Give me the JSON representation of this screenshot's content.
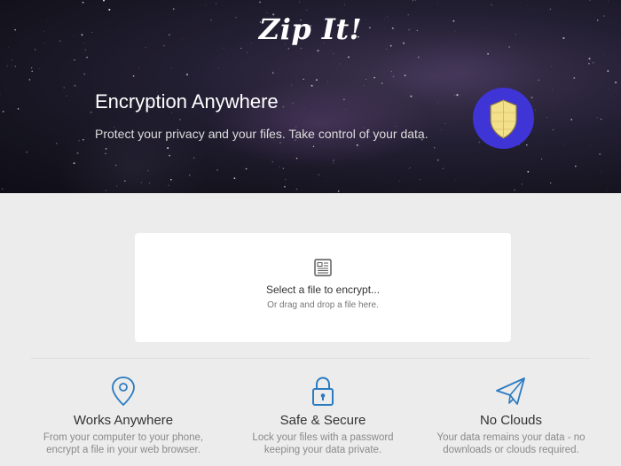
{
  "header": {
    "logo": "Zip It!",
    "title": "Encryption Anywhere",
    "subtitle": "Protect your privacy and your files. Take control of your data.",
    "badge_icon": "shield-icon",
    "badge_color": "#3f34d6",
    "shield_color": "#f2e08a"
  },
  "dropzone": {
    "icon": "document-icon",
    "title": "Select a file to encrypt...",
    "subtitle": "Or drag and drop a file here."
  },
  "features": [
    {
      "icon": "location-pin-icon",
      "title": "Works Anywhere",
      "line1": "From your computer to your phone,",
      "line2": "encrypt a file in your web browser."
    },
    {
      "icon": "lock-icon",
      "title": "Safe & Secure",
      "line1": "Lock your files with a password",
      "line2": "keeping your data private."
    },
    {
      "icon": "paper-plane-icon",
      "title": "No Clouds",
      "line1": "Your data remains your data - no",
      "line2": "downloads or clouds required."
    }
  ],
  "accent_color": "#2b7bc0"
}
